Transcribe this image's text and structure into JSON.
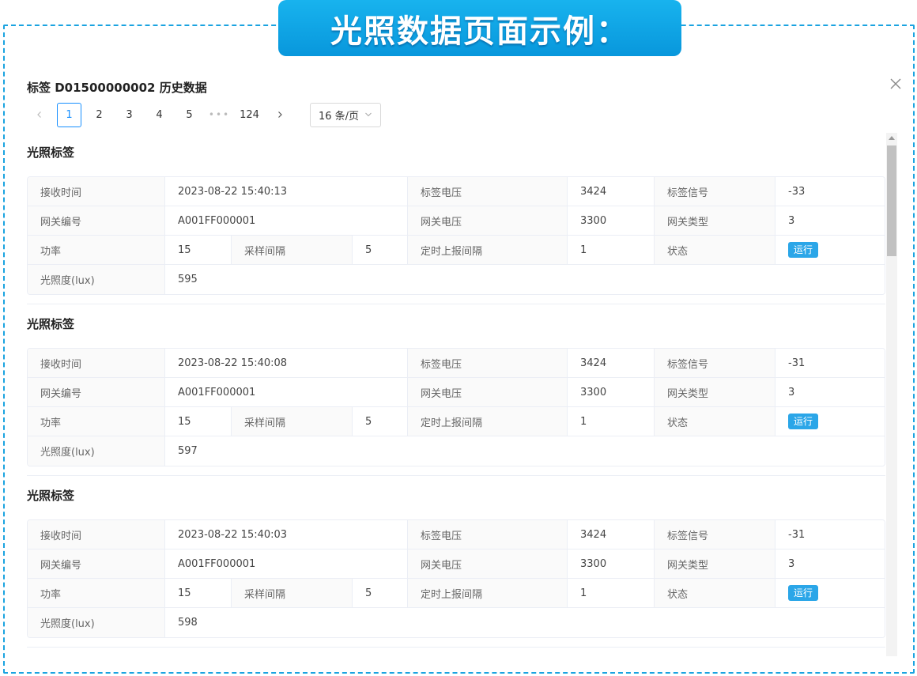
{
  "banner": {
    "title": "光照数据页面示例："
  },
  "modal": {
    "title": "标签 D01500000002 历史数据"
  },
  "pagination": {
    "pages": [
      "1",
      "2",
      "3",
      "4",
      "5"
    ],
    "ellipsis": "•••",
    "last_page": "124",
    "current": "1",
    "page_size": "16 条/页"
  },
  "colors": {
    "accent": "#1890ff",
    "banner": "#0fa5e6",
    "status_tag": "#2ba6e8"
  },
  "labels": {
    "receive_time": "接收时间",
    "tag_voltage": "标签电压",
    "tag_signal": "标签信号",
    "gateway_id": "网关编号",
    "gateway_voltage": "网关电压",
    "gateway_type": "网关类型",
    "power": "功率",
    "sample_interval": "采样间隔",
    "report_interval": "定时上报间隔",
    "status": "状态",
    "illuminance": "光照度(lux)"
  },
  "records": [
    {
      "title": "光照标签",
      "receive_time": "2023-08-22 15:40:13",
      "tag_voltage": "3424",
      "tag_signal": "-33",
      "gateway_id": "A001FF000001",
      "gateway_voltage": "3300",
      "gateway_type": "3",
      "power": "15",
      "sample_interval": "5",
      "report_interval": "1",
      "status": "运行",
      "illuminance": "595"
    },
    {
      "title": "光照标签",
      "receive_time": "2023-08-22 15:40:08",
      "tag_voltage": "3424",
      "tag_signal": "-31",
      "gateway_id": "A001FF000001",
      "gateway_voltage": "3300",
      "gateway_type": "3",
      "power": "15",
      "sample_interval": "5",
      "report_interval": "1",
      "status": "运行",
      "illuminance": "597"
    },
    {
      "title": "光照标签",
      "receive_time": "2023-08-22 15:40:03",
      "tag_voltage": "3424",
      "tag_signal": "-31",
      "gateway_id": "A001FF000001",
      "gateway_voltage": "3300",
      "gateway_type": "3",
      "power": "15",
      "sample_interval": "5",
      "report_interval": "1",
      "status": "运行",
      "illuminance": "598"
    }
  ]
}
